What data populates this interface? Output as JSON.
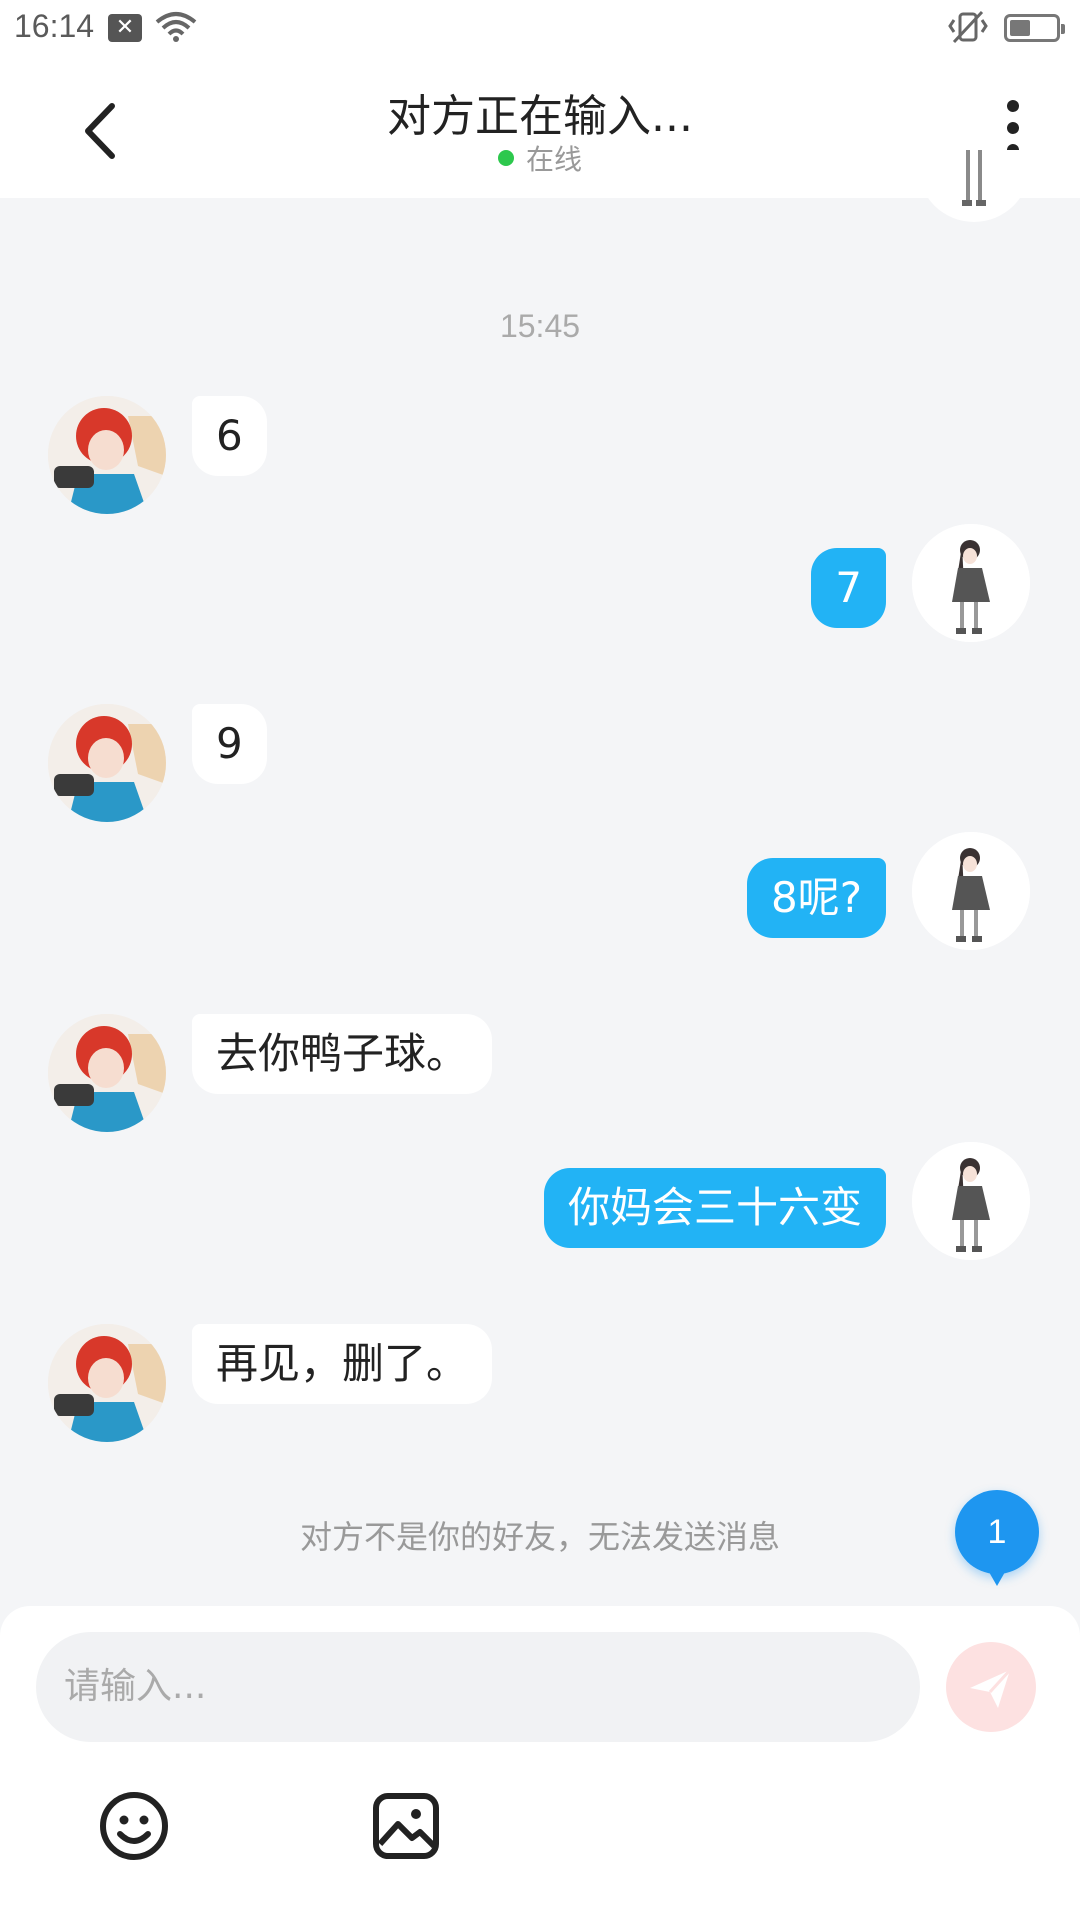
{
  "status_bar": {
    "time": "16:14"
  },
  "header": {
    "title": "对方正在输入...",
    "status": "在线"
  },
  "chat": {
    "timestamp": "15:45",
    "messages": [
      {
        "side": "in",
        "text": "6"
      },
      {
        "side": "out",
        "text": "7"
      },
      {
        "side": "in",
        "text": "9"
      },
      {
        "side": "out",
        "text": "8呢?"
      },
      {
        "side": "in",
        "text": "去你鸭子球。"
      },
      {
        "side": "out",
        "text": "你妈会三十六变"
      },
      {
        "side": "in",
        "text": "再见，删了。"
      }
    ],
    "notice": "对方不是你的好友，无法发送消息",
    "unread_count": "1"
  },
  "composer": {
    "placeholder": "请输入..."
  },
  "colors": {
    "accent": "#22b3f5",
    "online": "#2dc84d",
    "badge": "#1e96f0"
  },
  "icons": [
    "back-arrow-icon",
    "more-vertical-icon",
    "send-icon",
    "emoji-icon",
    "image-icon",
    "wifi-icon",
    "vibrate-icon",
    "battery-icon"
  ]
}
